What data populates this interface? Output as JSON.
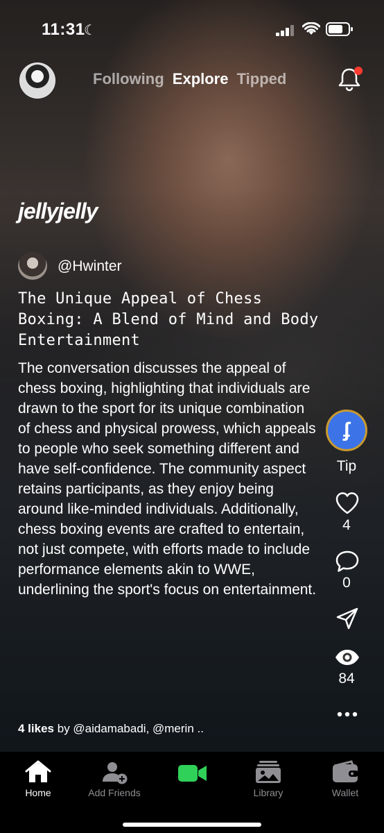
{
  "status_bar": {
    "time": "11:31",
    "moon": "☾"
  },
  "top_nav": {
    "tabs": [
      {
        "label": "Following",
        "active": false
      },
      {
        "label": "Explore",
        "active": true
      },
      {
        "label": "Tipped",
        "active": false
      }
    ],
    "notification_badge": true
  },
  "post": {
    "brand": "jellyjelly",
    "author": "@Hwinter",
    "title": "The Unique Appeal of Chess Boxing: A Blend of Mind and Body Entertainment",
    "description": "The conversation discusses the appeal of chess boxing, highlighting that individuals are drawn to the sport for its unique combination of chess and physical prowess, which appeals to people who seek something different and have self-confidence. The community aspect retains participants, as they enjoy being around like-minded individuals. Additionally, chess boxing events are crafted to entertain, not just compete, with efforts made to include performance elements akin to WWE, underlining the sport's focus on entertainment.",
    "likes_count": "4 likes",
    "likes_by": "by @aidamabadi, @merin .."
  },
  "actions": {
    "tip_label": "Tip",
    "tip_icon_glyph": "ʄ",
    "likes": "4",
    "comments": "0",
    "views": "84"
  },
  "tab_bar": {
    "items": [
      {
        "label": "Home",
        "icon": "home-icon",
        "active": true
      },
      {
        "label": "Add Friends",
        "icon": "add-friend-icon",
        "active": false
      },
      {
        "label": "",
        "icon": "video-camera-icon",
        "active": false
      },
      {
        "label": "Library",
        "icon": "library-icon",
        "active": false
      },
      {
        "label": "Wallet",
        "icon": "wallet-icon",
        "active": false
      }
    ]
  },
  "colors": {
    "accent_green": "#30d158",
    "tip_blue": "#3c74e8",
    "tip_ring": "#c99a2e",
    "badge_red": "#ff3b30"
  }
}
